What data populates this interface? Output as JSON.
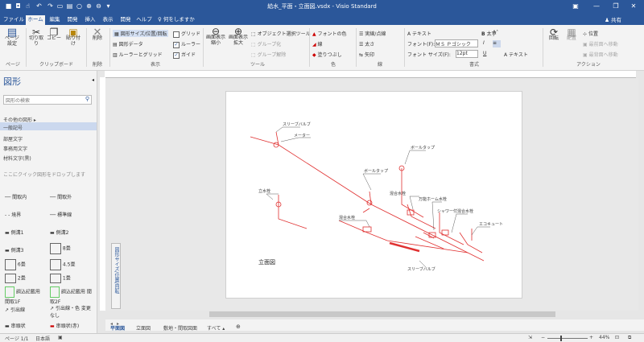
{
  "titlebar": {
    "doc_title": "給水_平面・立面図.vsdx - Visio Standard",
    "quick_access": [
      "save-icon",
      "camera-icon",
      "touch-icon",
      "undo-icon",
      "redo-icon",
      "page-icon",
      "print-preview-icon",
      "circle-icon",
      "zoom-in-icon",
      "zoom-icon",
      "more-icon"
    ],
    "window_buttons": [
      "ribbon-display",
      "minimize",
      "restore",
      "close"
    ]
  },
  "tabs": [
    "ファイル",
    "ホーム",
    "編集",
    "開発",
    "挿入",
    "表示",
    "開発",
    "ヘルプ"
  ],
  "active_tab": "ホーム",
  "tellme": "何をしますか",
  "share": "共有",
  "ribbon": {
    "page": {
      "label": "ページ",
      "btn": "ページ設定"
    },
    "clipboard": {
      "label": "クリップボード",
      "cut": "切り取り",
      "copy": "コピー",
      "paste": "貼り付け"
    },
    "delete": {
      "label": "削除",
      "btn": "削除"
    },
    "display": {
      "label": "表示",
      "items": [
        "図形サイズ/位置/回転",
        "図形データ",
        "ルーラーとグリッド"
      ],
      "checks": [
        {
          "label": "グリッド",
          "checked": false
        },
        {
          "label": "ルーラー",
          "checked": true
        },
        {
          "label": "ガイド",
          "checked": true
        }
      ]
    },
    "tools": {
      "label": "ツール",
      "zoom_fit": "画面表示 縮小",
      "zoom_in": "画面表示 拡大",
      "items": [
        "オブジェクト選択ツール",
        "グループ化",
        "グループ解除"
      ]
    },
    "color": {
      "label": "色",
      "items": [
        "フォントの色",
        "線",
        "塗りつぶし"
      ]
    },
    "line": {
      "label": "線",
      "items": [
        "実線/点線",
        "太さ",
        "矢印"
      ]
    },
    "format": {
      "label": "書式",
      "text": "テキスト",
      "font_label": "フォント(F):",
      "font_value": "ＭＳ Ｐゴシック",
      "size_label": "フォント サイズ(F):",
      "size_value": "12pt",
      "bold": "太字",
      "italic": "I",
      "underline": "U",
      "text2": "テキスト"
    },
    "action": {
      "label": "アクション",
      "rotate": "回転",
      "arrange": "配置",
      "position": "位置",
      "items": [
        "最前面へ移動",
        "最背面へ移動"
      ]
    }
  },
  "shapes_pane": {
    "title": "図形",
    "search_placeholder": "図形の検索",
    "more_shapes": "その他の図形",
    "stencils": [
      "一般記号",
      "部屋文字",
      "事務用文字",
      "材料文字(黒)"
    ],
    "active_stencil": "一般記号",
    "drop_hint": "ここにクイック図形をドロップします",
    "items": [
      [
        "間取内",
        "間取外"
      ],
      [
        "境界",
        "標準線"
      ],
      [
        "側溝1",
        "側溝2"
      ],
      [
        "側溝3",
        "8畳"
      ],
      [
        "6畳",
        "4.5畳"
      ],
      [
        "2畳",
        "1畳"
      ],
      [
        "調込記載用 間取1F",
        "調込記載用 間取2F"
      ],
      [
        "引出線",
        "引出線・色 変更なし"
      ],
      [
        "串頭状",
        "串頭状(赤)"
      ]
    ]
  },
  "drawing": {
    "page_label": "立面図",
    "annotations": [
      "スリーブバルブ",
      "メーター",
      "ボールタップ",
      "ボールタップ",
      "立水栓",
      "混合水栓",
      "混合水栓",
      "万能ホーム水栓",
      "シャワー付混合水栓",
      "エコキュート",
      "スリーブバルブ"
    ]
  },
  "sidetab": "図形サイズ/位置/回転",
  "page_tabs": [
    "平面図",
    "立面図",
    "敷地・間取図面",
    "すべて"
  ],
  "active_page_tab": "平面図",
  "status": {
    "page": "ページ 1/1",
    "lang": "日本語",
    "zoom": "44%"
  }
}
